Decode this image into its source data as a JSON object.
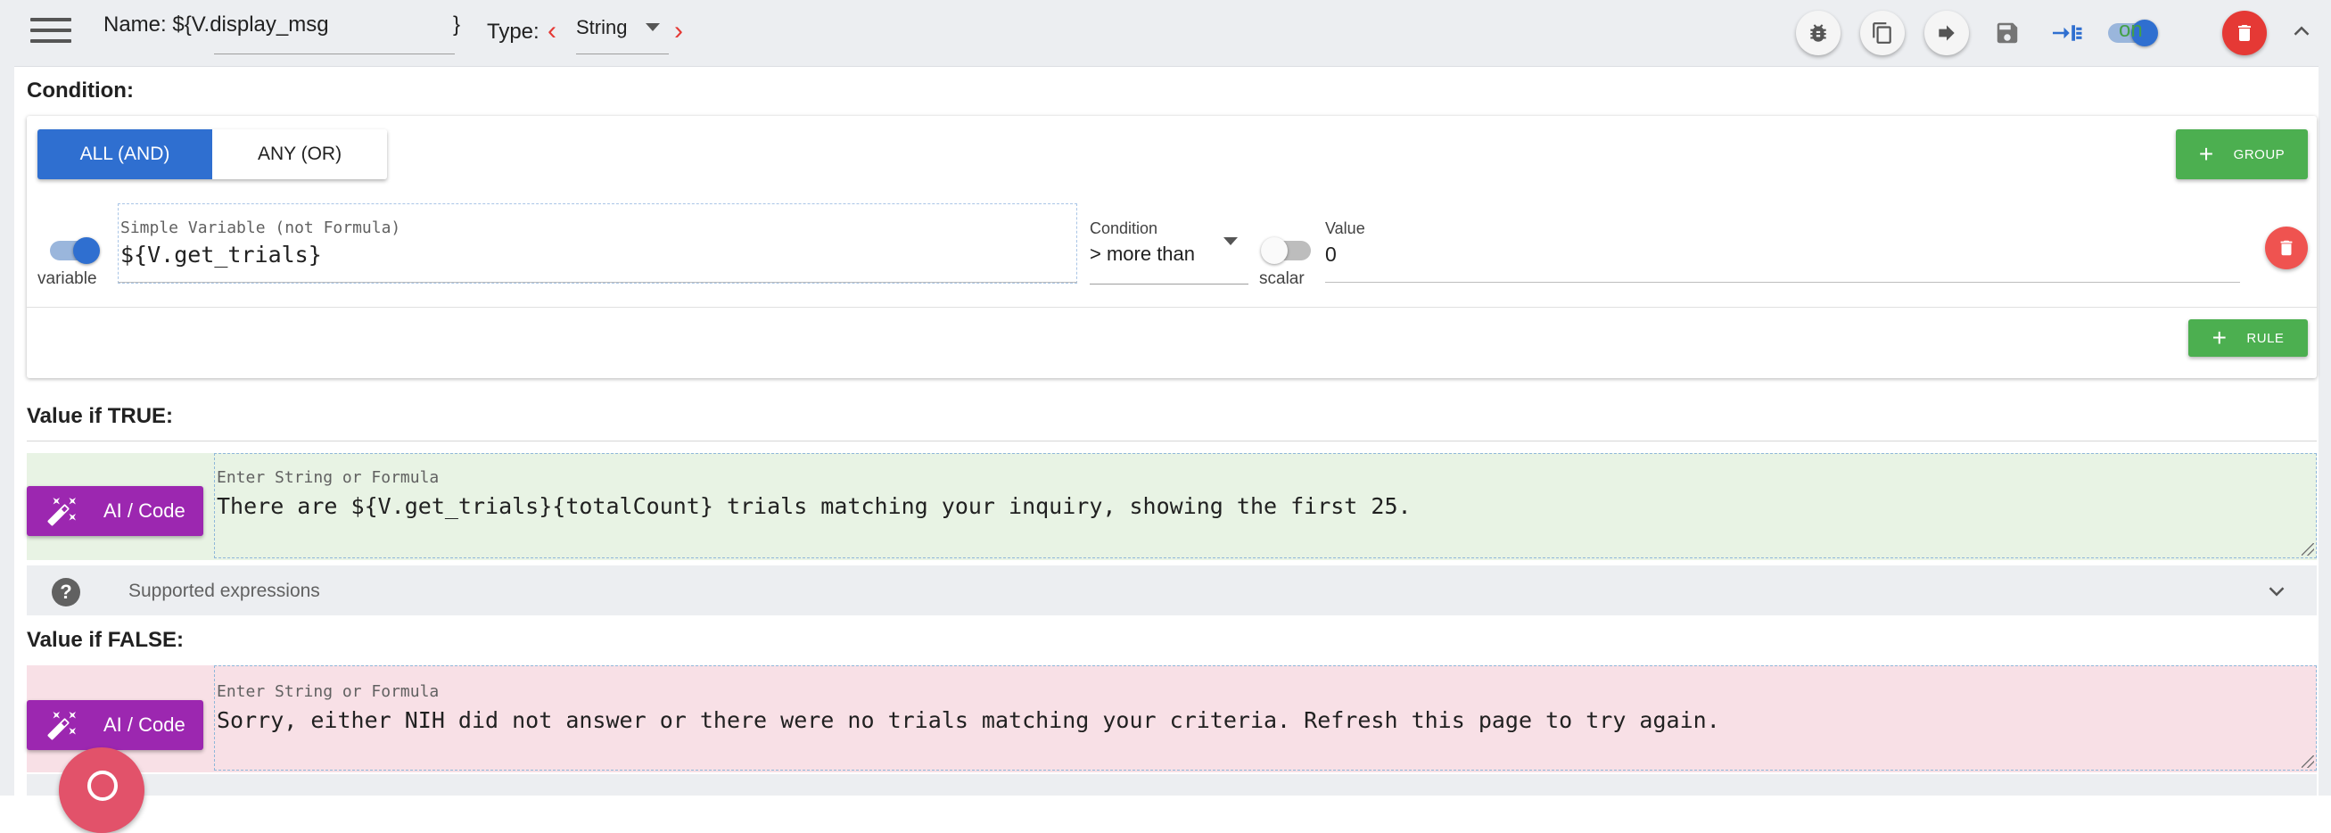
{
  "toolbar": {
    "name_label": "Name: ${V.display_msg",
    "name_close_brace": "}",
    "type_label": "Type:",
    "type_prev_icon": "chevron-left-icon",
    "type_value": "String",
    "type_next_icon": "chevron-right-icon",
    "actions": [
      "bug-icon",
      "copy-icon",
      "forward-arrow-icon",
      "save-icon",
      "indent-icon"
    ],
    "enabled_label": "on",
    "accent_color": "#2f6fd0",
    "danger_color": "#e53935"
  },
  "condition": {
    "heading": "Condition:",
    "mode_all": "ALL (AND)",
    "mode_any": "ANY (OR)",
    "group_button": "GROUP",
    "rule": {
      "variable_toggle_label": "variable",
      "variable_field_hint": "Simple Variable (not Formula)",
      "variable_value": "${V.get_trials}",
      "condition_label": "Condition",
      "condition_value": "> more than",
      "scalar_toggle_label": "scalar",
      "value_label": "Value",
      "value_value": "0"
    },
    "rule_button": "RULE"
  },
  "true_branch": {
    "heading": "Value if TRUE:",
    "ai_button": "AI / Code",
    "field_hint": "Enter String or Formula",
    "value": "There are ${V.get_trials}{totalCount} trials matching your inquiry, showing the first 25.",
    "bg_color": "#e8f3e4"
  },
  "expressions": {
    "label": "Supported expressions"
  },
  "false_branch": {
    "heading": "Value if FALSE:",
    "ai_button": "AI / Code",
    "field_hint": "Enter String or Formula",
    "value": "Sorry, either NIH did not answer or there were no trials matching your criteria. Refresh this page to try again.",
    "bg_color": "#f8e0e6"
  }
}
